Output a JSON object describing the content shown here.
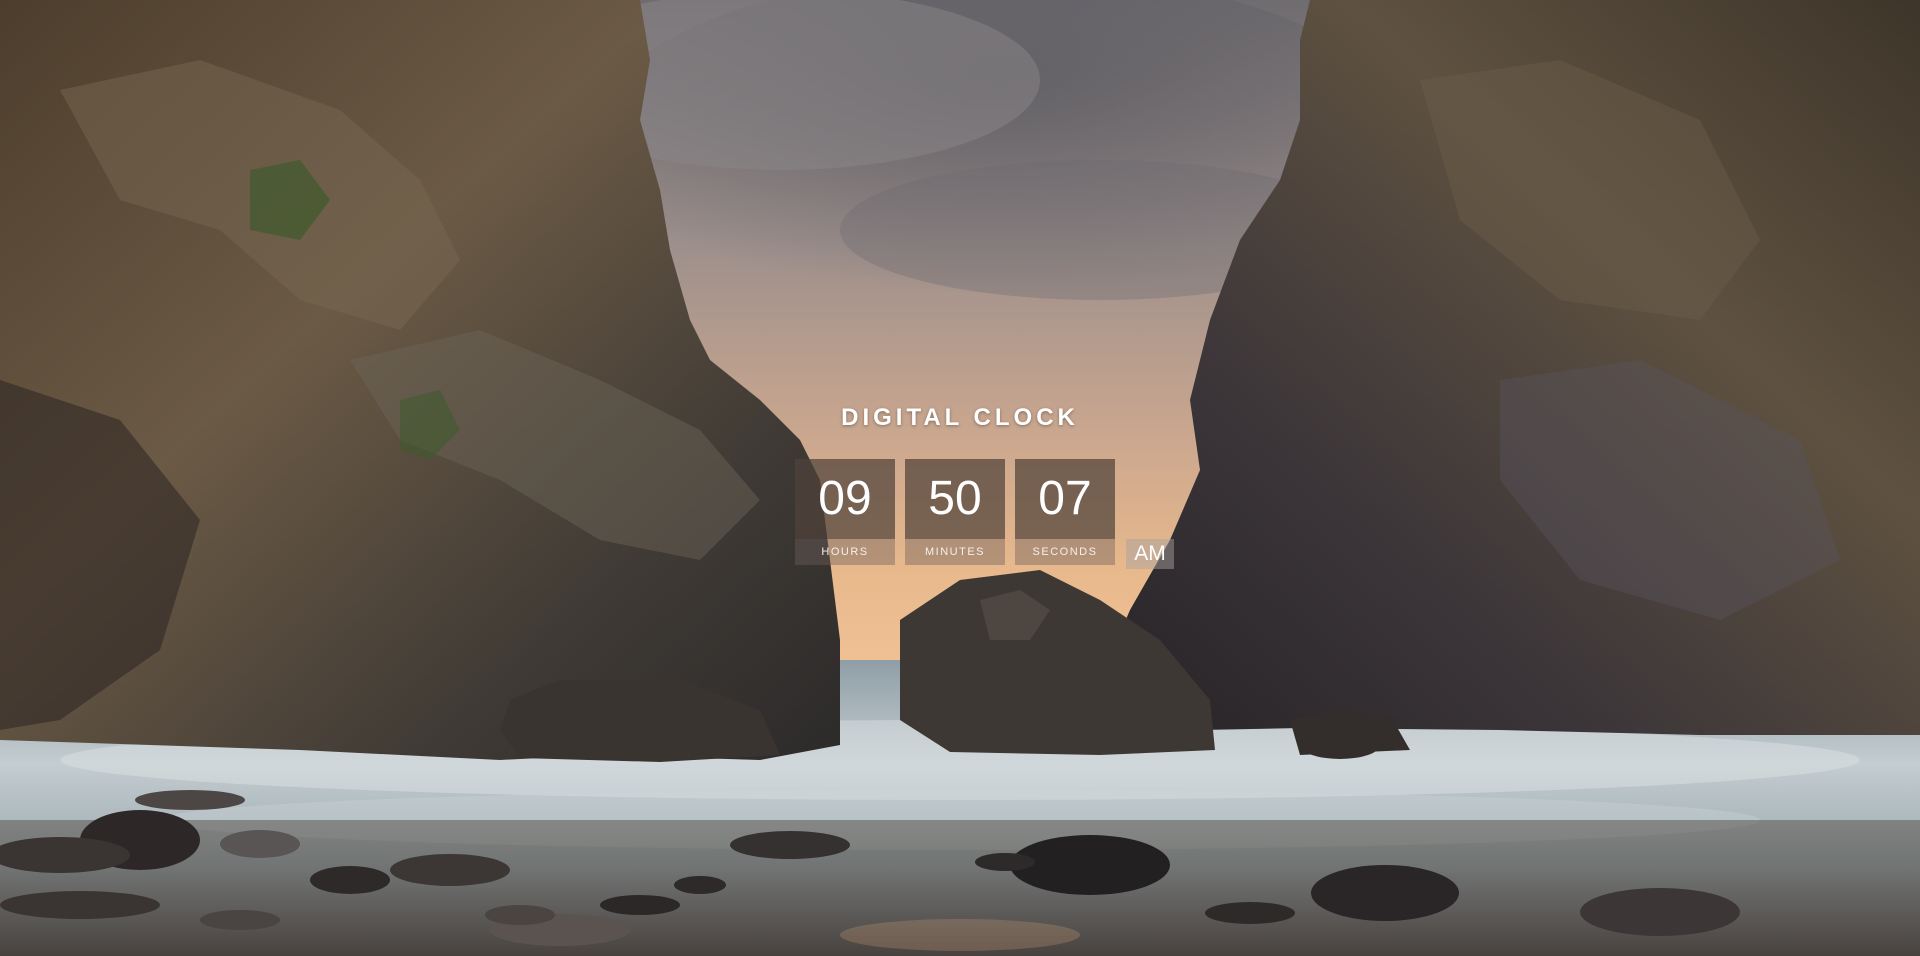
{
  "clock": {
    "title": "DIGITAL CLOCK",
    "hours": "09",
    "minutes": "50",
    "seconds": "07",
    "hours_label": "HOURS",
    "minutes_label": "MINUTES",
    "seconds_label": "SECONDS",
    "period": "AM"
  },
  "background": {
    "description_colors": {
      "sky_top": "#7d7a7d",
      "sky_glow": "#e3b38c",
      "rock": "#3a322a",
      "sea": "#a9b4b7"
    }
  }
}
